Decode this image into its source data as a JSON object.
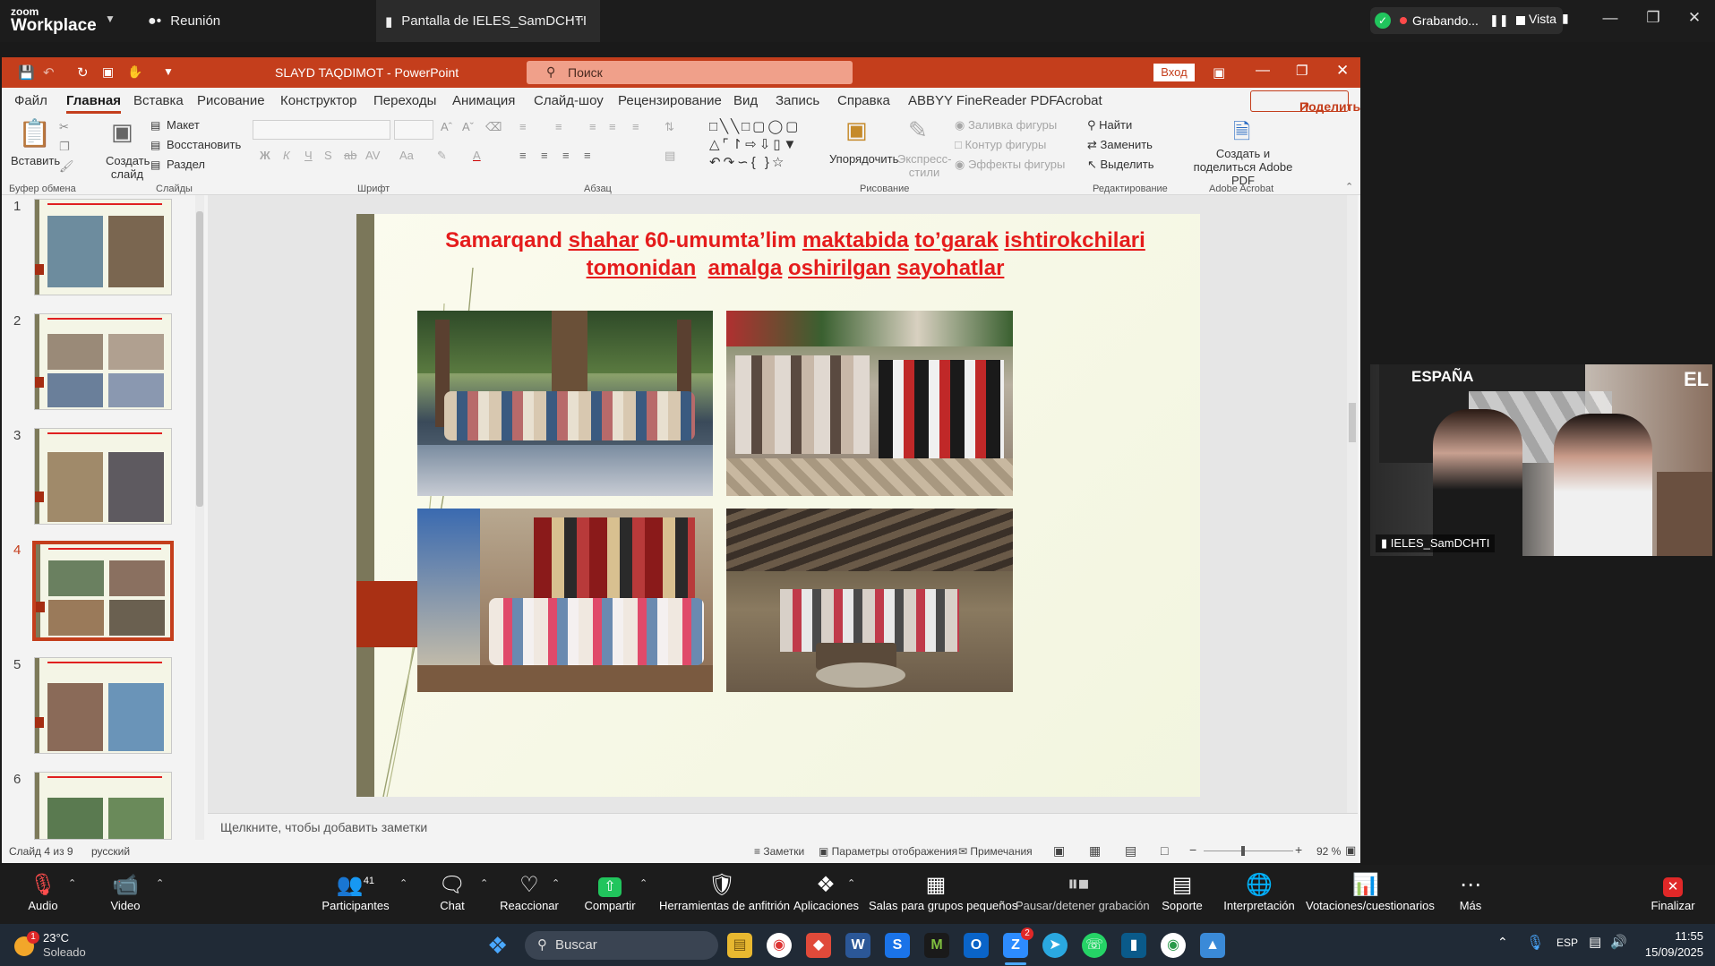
{
  "zoom_top": {
    "brand_small": "zoom",
    "brand_big": "Workplace",
    "meeting_tab": "Reunión",
    "share_tab": "Pantalla de IELES_SamDCHTI",
    "recording_label": "Grabando...",
    "view_label": "Vista"
  },
  "ppt": {
    "title": "SLAYD TAQDIMOT  -  PowerPoint",
    "search_placeholder": "Поиск",
    "login": "Вход",
    "share_btn": "Поделиться",
    "menu": [
      "Файл",
      "Главная",
      "Вставка",
      "Рисование",
      "Конструктор",
      "Переходы",
      "Анимация",
      "Слайд-шоу",
      "Рецензирование",
      "Вид",
      "Запись",
      "Справка",
      "ABBYY FineReader PDF",
      "Acrobat"
    ],
    "ribbon": {
      "paste": "Вставить",
      "new_slide": "Создать слайд",
      "layout": "Макет",
      "reset": "Восстановить",
      "section": "Раздел",
      "arrange": "Упорядочить",
      "express_styles": "Экспресс-стили",
      "shape_fill": "Заливка фигуры",
      "shape_outline": "Контур фигуры",
      "shape_effects": "Эффекты фигуры",
      "find": "Найти",
      "replace": "Заменить",
      "select": "Выделить",
      "adobe": "Создать и поделиться Adobe PDF",
      "groups": {
        "clipboard": "Буфер обмена",
        "slides": "Слайды",
        "font": "Шрифт",
        "paragraph": "Абзац",
        "drawing": "Рисование",
        "editing": "Редактирование",
        "acrobat": "Adobe Acrobat"
      }
    },
    "thumb_numbers": [
      "1",
      "2",
      "3",
      "4",
      "5",
      "6"
    ],
    "slide_title_parts": [
      "Samarqand",
      "shahar",
      "60-umumta’lim",
      "maktabida",
      "to’garak",
      "ishtirokchilari",
      "tomonidan",
      "amalga",
      "oshirilgan",
      "sayohatlar"
    ],
    "notes_placeholder": "Щелкните, чтобы добавить заметки",
    "status": {
      "slide_info": "Слайд 4 из 9",
      "language": "русский",
      "notes": "Заметки",
      "display_settings": "Параметры отображения",
      "comments": "Примечания",
      "zoom": "92 %"
    }
  },
  "video": {
    "participant": "IELES_SamDCHTI",
    "wall_text": "ESPAÑA",
    "wall_text2": "EL"
  },
  "zoom_bar": {
    "audio": "Audio",
    "video": "Video",
    "participants": "Participantes",
    "participants_count": "41",
    "chat": "Chat",
    "react": "Reaccionar",
    "share": "Compartir",
    "host_tools": "Herramientas de anfitrión",
    "apps": "Aplicaciones",
    "breakout": "Salas para grupos pequeños",
    "pause_rec": "Pausar/detener grabación",
    "support": "Soporte",
    "interpretation": "Interpretación",
    "polls": "Votaciones/cuestionarios",
    "more": "Más",
    "end": "Finalizar"
  },
  "taskbar": {
    "weather_temp": "23°C",
    "weather_desc": "Soleado",
    "weather_badge": "1",
    "search": "Buscar",
    "lang": "ESP",
    "time": "11:55",
    "date": "15/09/2025",
    "zoom_badge": "2"
  },
  "colors": {
    "ppt_accent": "#c43e1c",
    "slide_title": "#e51c1c",
    "share_green": "#21c55d"
  }
}
